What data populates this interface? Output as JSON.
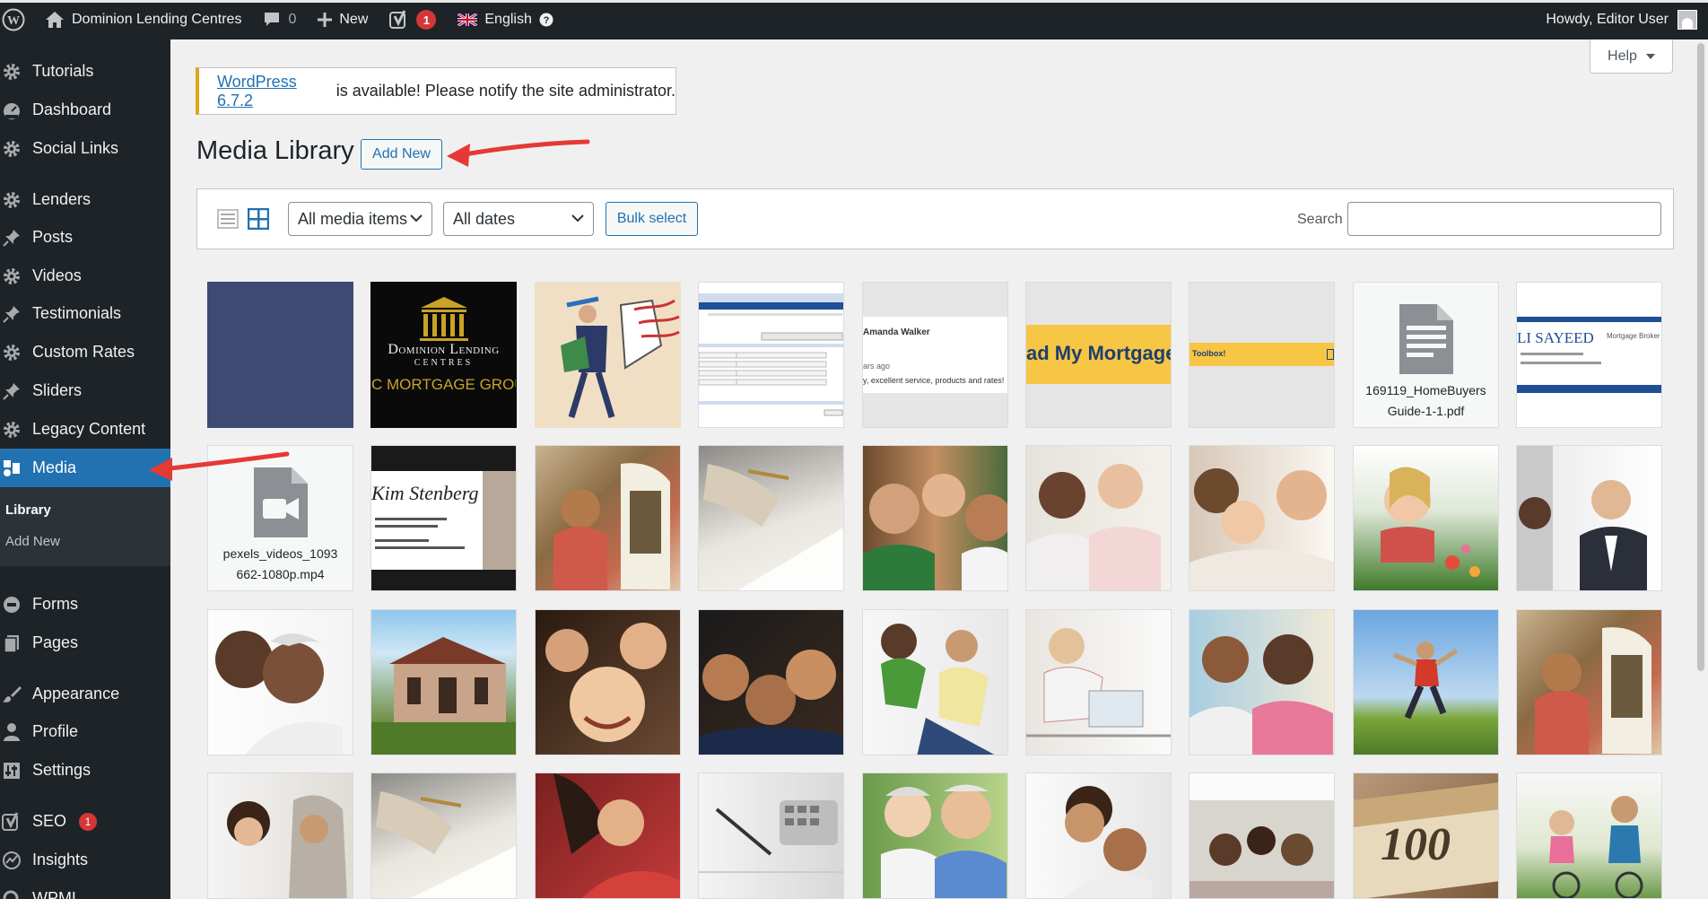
{
  "adminbar": {
    "site_name": "Dominion Lending Centres",
    "comments_count": "0",
    "new_label": "New",
    "yoast_count": "1",
    "language": "English",
    "howdy": "Howdy, Editor User"
  },
  "sidebar": {
    "items": [
      {
        "label": "Tutorials",
        "icon": "gear-icon"
      },
      {
        "label": "Dashboard",
        "icon": "dashboard-icon"
      },
      {
        "label": "Social Links",
        "icon": "gear-icon"
      },
      {
        "label": "Lenders",
        "icon": "gear-icon"
      },
      {
        "label": "Posts",
        "icon": "pin-icon"
      },
      {
        "label": "Videos",
        "icon": "gear-icon"
      },
      {
        "label": "Testimonials",
        "icon": "pin-icon"
      },
      {
        "label": "Custom Rates",
        "icon": "gear-icon"
      },
      {
        "label": "Sliders",
        "icon": "pin-icon"
      },
      {
        "label": "Legacy Content",
        "icon": "gear-icon"
      },
      {
        "label": "Media",
        "icon": "media-icon"
      },
      {
        "label": "Forms",
        "icon": "forms-icon"
      },
      {
        "label": "Pages",
        "icon": "pages-icon"
      },
      {
        "label": "Appearance",
        "icon": "brush-icon"
      },
      {
        "label": "Profile",
        "icon": "user-icon"
      },
      {
        "label": "Settings",
        "icon": "settings-icon"
      },
      {
        "label": "SEO",
        "icon": "yoast-icon",
        "badge": "1"
      },
      {
        "label": "Insights",
        "icon": "insights-icon"
      },
      {
        "label": "WPML",
        "icon": "wpml-icon"
      }
    ],
    "submenu": [
      "Library",
      "Add New"
    ]
  },
  "help": "Help",
  "notice": {
    "link": "WordPress 6.7.2",
    "text": " is available! Please notify the site administrator."
  },
  "page": {
    "title": "Media Library",
    "add_new": "Add New"
  },
  "toolbar": {
    "filter_type": "All media items",
    "filter_date": "All dates",
    "bulk_select": "Bulk select",
    "search_label": "Search",
    "search_value": ""
  },
  "tiles": {
    "pdf_caption": "169119_HomeBuyers Guide-1-1.pdf",
    "video_caption": "pexels_videos_1093 662-1080p.mp4",
    "dlc_logo_text": "Dominion Lending",
    "dlc_logo_sub": "CENTRES",
    "dlc_logo_mort": "C MORTGAGE GROU",
    "amanda": "Amanda Walker",
    "amanda_sub": "ars ago",
    "amanda_quote": "y, excellent service, products and rates!",
    "my_mortgage": "ad My Mortgage",
    "toolbox": "Toolbox!",
    "sayeed": "LI SAYEED",
    "sayeed_sub": "Mortgage Broker",
    "kim": "Kim Stenberg",
    "bill": "100"
  }
}
